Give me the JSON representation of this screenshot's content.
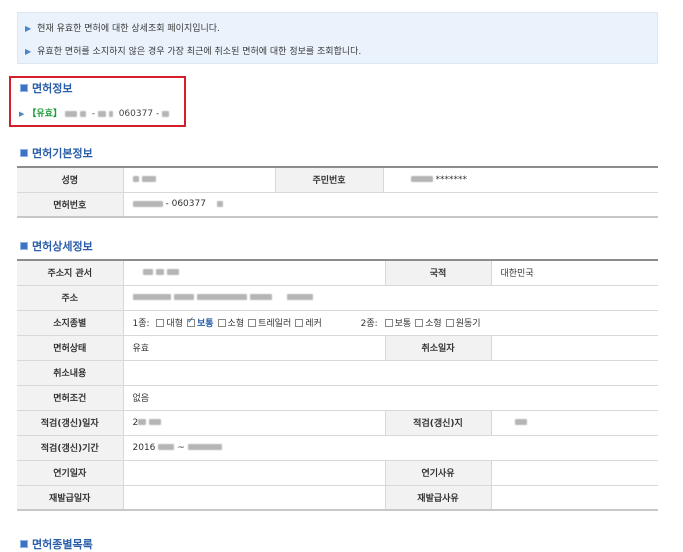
{
  "notice": {
    "line1": "현재 유효한 면허에 대한 상세조회 페이지입니다.",
    "line2": "유효한 면허를 소지하지 않은 경우 가장 최근에 취소된 면허에 대한 정보를 조회합니다."
  },
  "license_info": {
    "title": "면허정보",
    "status_tag": "【유효】",
    "number_dash1": "-",
    "number_mid": "060377",
    "number_dash2": "-"
  },
  "basic": {
    "title": "면허기본정보",
    "name_label": "성명",
    "rrn_label": "주민번호",
    "rrn_mask": "*******",
    "license_no_label": "면허번호",
    "license_no_mid": "- 060377"
  },
  "detail": {
    "title": "면허상세정보",
    "office_label": "주소지 관서",
    "nationality_label": "국적",
    "nationality_value": "대한민국",
    "address_label": "주소",
    "class_label": "소지종별",
    "class1_prefix": "1종:",
    "class1_items": [
      {
        "label": "대형",
        "checked": false
      },
      {
        "label": "보통",
        "checked": true
      },
      {
        "label": "소형",
        "checked": false
      },
      {
        "label": "트레일러",
        "checked": false
      },
      {
        "label": "레커",
        "checked": false
      }
    ],
    "class2_prefix": "2종:",
    "class2_items": [
      {
        "label": "보통",
        "checked": false
      },
      {
        "label": "소형",
        "checked": false
      },
      {
        "label": "원동기",
        "checked": false
      }
    ],
    "status_label": "면허상태",
    "status_value": "유효",
    "cancel_date_label": "취소일자",
    "cancel_content_label": "취소내용",
    "condition_label": "면허조건",
    "condition_value": "없음",
    "renew_date_label": "적검(갱신)일자",
    "renew_date_prefix": "2",
    "renew_place_label": "적검(갱신)지",
    "renew_period_label": "적검(갱신)기간",
    "renew_period_start": "2016",
    "renew_period_sep": "~",
    "delay_date_label": "연기일자",
    "delay_reason_label": "연기사유",
    "reissue_date_label": "재발급일자",
    "reissue_reason_label": "재발급사유"
  },
  "next_section": {
    "title": "면허종별목록"
  },
  "colors": {
    "accent": "#2a5ea8",
    "highlight_box": "#d21f2b",
    "valid_green": "#1f9d3a",
    "notice_bg": "#eaf3fb"
  }
}
